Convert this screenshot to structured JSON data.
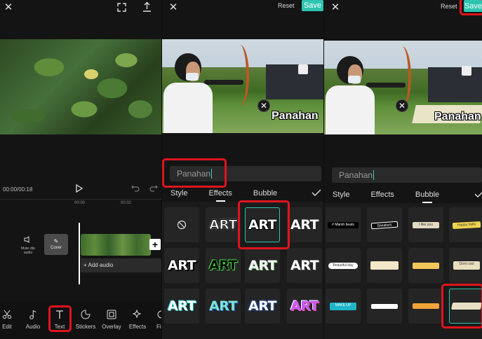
{
  "panel1": {
    "timecode": "00:00/00:18",
    "ruler": [
      "00:00",
      "00:02"
    ],
    "mute_label": "Mute clip audio",
    "cover_label": "Cover",
    "add_audio_label": "+ Add audio",
    "nav": [
      {
        "label": "Edit",
        "icon": "scissors-icon"
      },
      {
        "label": "Audio",
        "icon": "music-note-icon"
      },
      {
        "label": "Text",
        "icon": "text-icon"
      },
      {
        "label": "Stickers",
        "icon": "sticker-icon"
      },
      {
        "label": "Overlay",
        "icon": "overlay-icon"
      },
      {
        "label": "Effects",
        "icon": "effects-icon"
      },
      {
        "label": "Fi",
        "icon": "filter-icon"
      }
    ]
  },
  "panel2": {
    "reset_label": "Reset",
    "save_label": "Save",
    "overlay_text": "Panahan",
    "input_value": "Panahan",
    "tabs": [
      "Style",
      "Effects",
      "Bubble"
    ],
    "art_label": "ART"
  },
  "panel3": {
    "reset_label": "Reset",
    "save_label": "Save",
    "overlay_text": "Panahan",
    "input_value": "Panahan",
    "tabs": [
      "Style",
      "Effects",
      "Bubble"
    ],
    "bubbles": {
      "r1c1": "# Marsh beats",
      "r1c2": "Sneakers",
      "r1c3": "I like you",
      "r1c4": "Happy hello",
      "r2c1": "Beautiful day",
      "r2c4": "Dont cool",
      "r3c1": "MAKE UP"
    }
  },
  "colors": {
    "accent": "#2ec4b0",
    "highlight": "#e0141e"
  }
}
